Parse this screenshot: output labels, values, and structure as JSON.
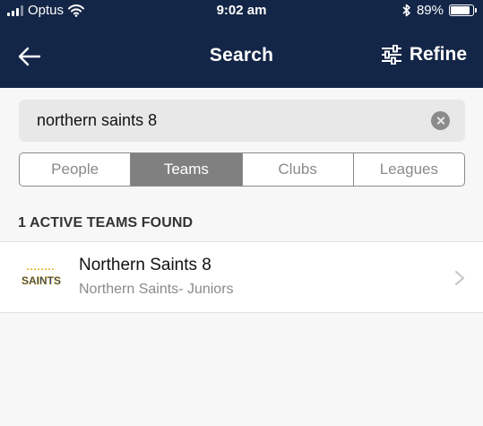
{
  "status_bar": {
    "carrier": "Optus",
    "time": "9:02 am",
    "battery_percent": "89%",
    "battery_level": 0.89,
    "icons": [
      "signal-icon",
      "wifi-icon",
      "bluetooth-icon",
      "battery-icon"
    ]
  },
  "header": {
    "title": "Search",
    "back_icon": "arrow-left-icon",
    "refine_label": "Refine",
    "refine_icon": "sliders-icon"
  },
  "search": {
    "value": "northern saints 8",
    "clear_icon": "clear-icon"
  },
  "tabs": [
    {
      "label": "People",
      "active": false
    },
    {
      "label": "Teams",
      "active": true
    },
    {
      "label": "Clubs",
      "active": false
    },
    {
      "label": "Leagues",
      "active": false
    }
  ],
  "results": {
    "count_label": "1 ACTIVE TEAMS FOUND",
    "items": [
      {
        "name": "Northern Saints 8",
        "club": "Northern Saints- Juniors",
        "logo_text": "SAINTS",
        "icon": "chevron-right-icon"
      }
    ]
  },
  "colors": {
    "header_bg": "#142647",
    "active_tab": "#808080",
    "logo_blue": "#1c3f86",
    "logo_gold": "#e0b323"
  }
}
